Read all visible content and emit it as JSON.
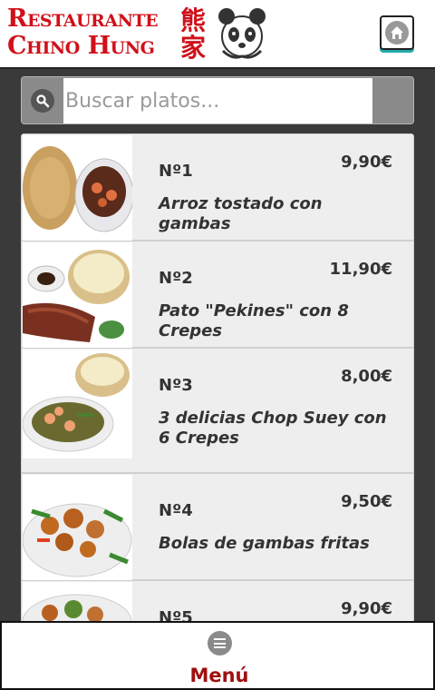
{
  "header": {
    "logo_line1": "Restaurante",
    "logo_line2": "Chino Hung",
    "logo_hanzi": "熊家",
    "home_icon": "home-icon"
  },
  "search": {
    "placeholder": "Buscar platos...",
    "value": ""
  },
  "dishes": [
    {
      "number": "Nº1",
      "price": "9,90€",
      "name": "Arroz tostado con gambas"
    },
    {
      "number": "Nº2",
      "price": "11,90€",
      "name": "Pato \"Pekines\" con 8 Crepes"
    },
    {
      "number": "Nº3",
      "price": "8,00€",
      "name": "3 delicias Chop Suey con 6 Crepes"
    },
    {
      "number": "Nº4",
      "price": "9,50€",
      "name": "Bolas de gambas fritas"
    },
    {
      "number": "Nº5",
      "price": "9,90€",
      "name": ""
    }
  ],
  "footer": {
    "menu_label": "Menú",
    "menu_icon": "menu-icon"
  },
  "colors": {
    "brand_red": "#d0101a",
    "menu_red": "#a01010",
    "row_bg": "#eeeeee"
  }
}
